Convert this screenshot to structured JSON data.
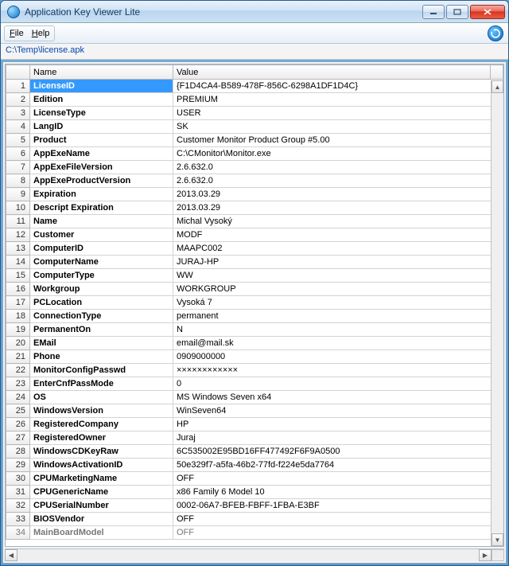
{
  "window": {
    "title": "Application Key Viewer Lite"
  },
  "menu": {
    "file": "File",
    "help": "Help"
  },
  "path": "C:\\Temp\\license.apk",
  "columns": {
    "name": "Name",
    "value": "Value"
  },
  "rows": [
    {
      "n": "1",
      "name": "LicenseID",
      "value": "{F1D4CA4-B589-478F-856C-6298A1DF1D4C}",
      "selected": true
    },
    {
      "n": "2",
      "name": "Edition",
      "value": "PREMIUM"
    },
    {
      "n": "3",
      "name": "LicenseType",
      "value": "USER"
    },
    {
      "n": "4",
      "name": "LangID",
      "value": "SK"
    },
    {
      "n": "5",
      "name": "Product",
      "value": "Customer Monitor Product Group #5.00"
    },
    {
      "n": "6",
      "name": "AppExeName",
      "value": "C:\\CMonitor\\Monitor.exe"
    },
    {
      "n": "7",
      "name": "AppExeFileVersion",
      "value": "2.6.632.0"
    },
    {
      "n": "8",
      "name": "AppExeProductVersion",
      "value": "2.6.632.0"
    },
    {
      "n": "9",
      "name": "Expiration",
      "value": "2013.03.29"
    },
    {
      "n": "10",
      "name": "Descript Expiration",
      "value": "2013.03.29"
    },
    {
      "n": "11",
      "name": "Name",
      "value": "Michal Vysoký"
    },
    {
      "n": "12",
      "name": "Customer",
      "value": "MODF"
    },
    {
      "n": "13",
      "name": "ComputerID",
      "value": "MAAPC002"
    },
    {
      "n": "14",
      "name": "ComputerName",
      "value": "JURAJ-HP"
    },
    {
      "n": "15",
      "name": "ComputerType",
      "value": "WW"
    },
    {
      "n": "16",
      "name": "Workgroup",
      "value": "WORKGROUP"
    },
    {
      "n": "17",
      "name": "PCLocation",
      "value": "Vysoká 7"
    },
    {
      "n": "18",
      "name": "ConnectionType",
      "value": "permanent"
    },
    {
      "n": "19",
      "name": "PermanentOn",
      "value": "N"
    },
    {
      "n": "20",
      "name": "EMail",
      "value": "email@mail.sk"
    },
    {
      "n": "21",
      "name": "Phone",
      "value": "0909000000"
    },
    {
      "n": "22",
      "name": "MonitorConfigPasswd",
      "value": "××××××××××××"
    },
    {
      "n": "23",
      "name": "EnterCnfPassMode",
      "value": "0"
    },
    {
      "n": "24",
      "name": "OS",
      "value": "MS Windows Seven x64"
    },
    {
      "n": "25",
      "name": "WindowsVersion",
      "value": "WinSeven64"
    },
    {
      "n": "26",
      "name": "RegisteredCompany",
      "value": "HP"
    },
    {
      "n": "27",
      "name": "RegisteredOwner",
      "value": "Juraj"
    },
    {
      "n": "28",
      "name": "WindowsCDKeyRaw",
      "value": "6C535002E95BD16FF477492F6F9A0500"
    },
    {
      "n": "29",
      "name": "WindowsActivationID",
      "value": "50e329f7-a5fa-46b2-77fd-f224e5da7764"
    },
    {
      "n": "30",
      "name": "CPUMarketingName",
      "value": "OFF"
    },
    {
      "n": "31",
      "name": "CPUGenericName",
      "value": "x86 Family 6 Model 10"
    },
    {
      "n": "32",
      "name": "CPUSerialNumber",
      "value": "0002-06A7-BFEB-FBFF-1FBA-E3BF"
    },
    {
      "n": "33",
      "name": "BIOSVendor",
      "value": "OFF"
    },
    {
      "n": "34",
      "name": "MainBoardModel",
      "value": "OFF",
      "cut": true
    }
  ]
}
